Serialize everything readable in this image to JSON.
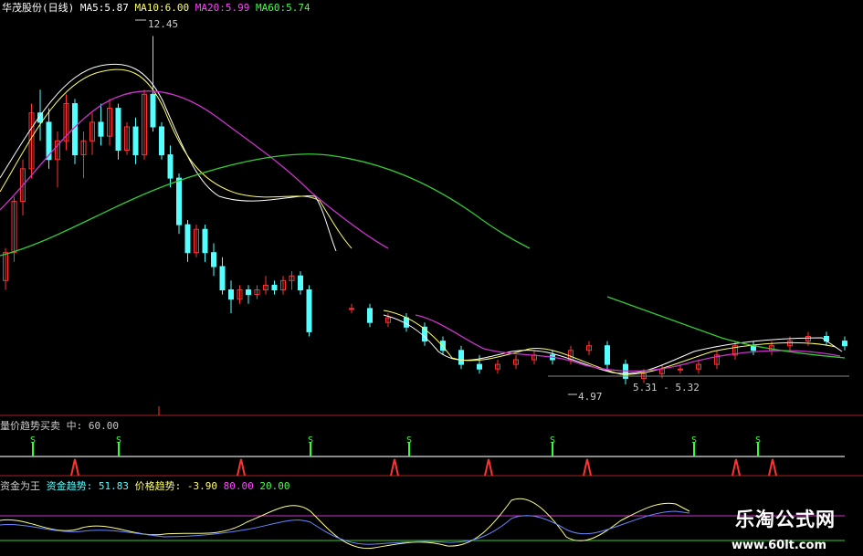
{
  "main_header": {
    "title": "华茂股份(日线)",
    "ma5": {
      "label": "MA5:",
      "value": "5.87",
      "color": "#ffffff"
    },
    "ma10": {
      "label": "MA10:",
      "value": "6.00",
      "color": "#ffff66"
    },
    "ma20": {
      "label": "MA20:",
      "value": "5.99",
      "color": "#ff44ff"
    },
    "ma60": {
      "label": "MA60:",
      "value": "5.74",
      "color": "#44ff44"
    }
  },
  "annotations": {
    "high": "12.45",
    "low": "4.97",
    "range": "5.31 - 5.32"
  },
  "panel2": {
    "title": "量价趋势买卖",
    "mid_label": "中:",
    "mid_value": "60.00",
    "buy_signal": "S"
  },
  "panel3": {
    "title": "资金为王",
    "fund_label": "资金趋势:",
    "fund_value": "51.83",
    "price_label": "价格趋势:",
    "price_value": "-3.90",
    "level_high": "80.00",
    "level_low": "20.00"
  },
  "watermark": {
    "line1": "乐淘公式网",
    "line2": "www.60lt.com"
  },
  "colors": {
    "up": "#ff3333",
    "down": "#54ffff",
    "ma5": "#ffffff",
    "ma10": "#ffff66",
    "ma20": "#cc33cc",
    "ma60": "#33cc33",
    "buy": "#33ff33",
    "sell": "#ff3333"
  },
  "chart_data": {
    "type": "candlestick",
    "ohlc_upper": [
      [
        7.2,
        7.9,
        7.0,
        7.8
      ],
      [
        7.8,
        9.0,
        7.6,
        8.9
      ],
      [
        8.9,
        9.8,
        8.6,
        9.6
      ],
      [
        9.6,
        11.0,
        9.4,
        10.8
      ],
      [
        10.8,
        11.3,
        10.2,
        10.6
      ],
      [
        10.6,
        10.9,
        9.6,
        9.8
      ],
      [
        9.8,
        10.4,
        9.2,
        10.2
      ],
      [
        10.2,
        11.2,
        10.0,
        11.0
      ],
      [
        11.0,
        11.1,
        9.7,
        9.9
      ],
      [
        9.9,
        10.4,
        9.4,
        10.2
      ],
      [
        10.2,
        10.8,
        9.9,
        10.6
      ],
      [
        10.6,
        11.0,
        10.1,
        10.3
      ],
      [
        10.3,
        11.1,
        10.1,
        10.9
      ],
      [
        10.9,
        11.0,
        9.8,
        10.0
      ],
      [
        10.0,
        10.6,
        9.9,
        10.5
      ],
      [
        10.5,
        10.7,
        9.7,
        9.9
      ],
      [
        9.9,
        11.3,
        9.8,
        11.2
      ],
      [
        11.2,
        12.45,
        10.4,
        10.5
      ],
      [
        10.5,
        10.6,
        9.8,
        9.9
      ],
      [
        9.9,
        10.1,
        9.2,
        9.4
      ],
      [
        9.4,
        9.5,
        8.2,
        8.4
      ],
      [
        8.4,
        8.5,
        7.6,
        7.8
      ],
      [
        7.8,
        8.4,
        7.7,
        8.3
      ],
      [
        8.3,
        8.4,
        7.6,
        7.8
      ],
      [
        7.8,
        8.0,
        7.3,
        7.5
      ],
      [
        7.5,
        7.7,
        6.9,
        7.0
      ],
      [
        7.0,
        7.2,
        6.5,
        6.8
      ],
      [
        6.8,
        7.1,
        6.7,
        7.0
      ],
      [
        7.0,
        7.1,
        6.7,
        6.9
      ],
      [
        6.9,
        7.1,
        6.8,
        7.0
      ],
      [
        7.0,
        7.3,
        6.9,
        7.1
      ],
      [
        7.1,
        7.2,
        6.9,
        7.0
      ],
      [
        7.0,
        7.3,
        6.9,
        7.2
      ],
      [
        7.2,
        7.4,
        7.0,
        7.3
      ],
      [
        7.3,
        7.4,
        6.9,
        7.0
      ],
      [
        7.0,
        7.1,
        6.0,
        6.1
      ]
    ],
    "ohlc_lower": [
      [
        6.6,
        6.7,
        6.5,
        6.6
      ],
      [
        6.6,
        6.7,
        6.2,
        6.3
      ],
      [
        6.3,
        6.5,
        6.2,
        6.4
      ],
      [
        6.4,
        6.5,
        6.1,
        6.2
      ],
      [
        6.2,
        6.3,
        5.8,
        5.9
      ],
      [
        5.9,
        6.0,
        5.6,
        5.7
      ],
      [
        5.7,
        5.8,
        5.3,
        5.4
      ],
      [
        5.4,
        5.6,
        5.2,
        5.3
      ],
      [
        5.3,
        5.5,
        5.2,
        5.4
      ],
      [
        5.4,
        5.6,
        5.3,
        5.5
      ],
      [
        5.5,
        5.7,
        5.4,
        5.6
      ],
      [
        5.6,
        5.7,
        5.4,
        5.5
      ],
      [
        5.5,
        5.8,
        5.4,
        5.7
      ],
      [
        5.7,
        5.9,
        5.6,
        5.8
      ],
      [
        5.8,
        5.9,
        5.3,
        5.4
      ],
      [
        5.4,
        5.5,
        4.97,
        5.1
      ],
      [
        5.1,
        5.3,
        5.0,
        5.2
      ],
      [
        5.2,
        5.4,
        5.1,
        5.3
      ],
      [
        5.3,
        5.4,
        5.2,
        5.3
      ],
      [
        5.3,
        5.5,
        5.2,
        5.4
      ],
      [
        5.4,
        5.7,
        5.3,
        5.6
      ],
      [
        5.6,
        5.9,
        5.5,
        5.8
      ],
      [
        5.8,
        5.9,
        5.6,
        5.7
      ],
      [
        5.7,
        5.9,
        5.6,
        5.8
      ],
      [
        5.8,
        6.0,
        5.7,
        5.9
      ],
      [
        5.9,
        6.1,
        5.8,
        6.0
      ],
      [
        6.0,
        6.1,
        5.8,
        5.9
      ],
      [
        5.9,
        6.0,
        5.7,
        5.8
      ]
    ]
  }
}
